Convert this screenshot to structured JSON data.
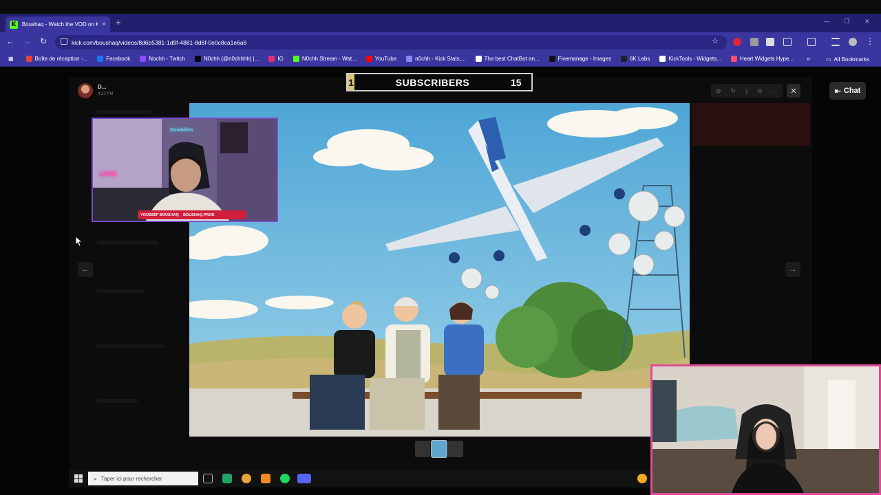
{
  "browser": {
    "tab_title": "Boushaq - Watch the VOD on K",
    "tab_close": "×",
    "new_tab": "+",
    "url": "kick.com/boushaq/videos/8d6b5381-1d9f-4881-8d6f-0e0c8ca1e6a6",
    "bookmarks": [
      {
        "label": "Boîte de réception -...",
        "color": "#ea4335"
      },
      {
        "label": "Facebook",
        "color": "#1877f2"
      },
      {
        "label": "Nochh - Twitch",
        "color": "#9146ff"
      },
      {
        "label": "N0chh (@n0chhhh) |...",
        "color": "#000000"
      },
      {
        "label": "IG",
        "color": "#e1306c"
      },
      {
        "label": "N0chh Stream - Wat...",
        "color": "#53fc18"
      },
      {
        "label": "YouTube",
        "color": "#ff0000"
      },
      {
        "label": "n0chh - Kick Stats,...",
        "color": "#8888ff"
      },
      {
        "label": "The best ChatBot an...",
        "color": "#ffffff"
      },
      {
        "label": "Fivemanage - Images",
        "color": "#111111"
      },
      {
        "label": "6K Labs",
        "color": "#222222"
      },
      {
        "label": "KickTools - Widgets...",
        "color": "#ffffff"
      },
      {
        "label": "Heart Widgets Hype...",
        "color": "#ff4d6d"
      }
    ],
    "all_bookmarks": "All Bookmarks",
    "accent": "#3a36a0"
  },
  "post": {
    "username": "D...",
    "time": "4:23 PM"
  },
  "subscribers": {
    "prefix": "1",
    "label": "SUBSCRIBERS",
    "count": "15"
  },
  "viewer": {
    "close": "✕",
    "prev": "←",
    "next": "→"
  },
  "chat_button": "Chat",
  "cam1": {
    "neon": "Goodvibes",
    "love": "LOVE",
    "tag1": "YOUSSEF BOUSHAQ",
    "tag2": "BOUSHAQ.PROD"
  },
  "taskbar": {
    "search_placeholder": "Taper ici pour rechercher"
  }
}
